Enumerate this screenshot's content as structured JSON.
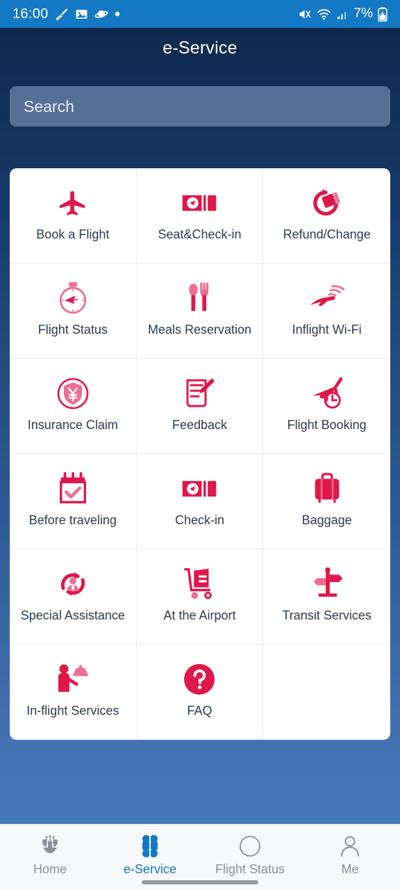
{
  "statusbar": {
    "time": "16:00",
    "icons_left": [
      "pen-icon",
      "photo-icon",
      "saturn-icon",
      "dot-icon"
    ],
    "icons_right": [
      "mute-icon",
      "wifi-icon",
      "signal-icon"
    ],
    "battery_text": "7%",
    "battery_icon": "battery-charging-icon",
    "bg_color": "#1379c4"
  },
  "header": {
    "title": "e-Service"
  },
  "search": {
    "placeholder": "Search",
    "icon": "search-field"
  },
  "theme": {
    "brand_pink": "#e0174b",
    "brand_pink_light": "#ee6f92",
    "accent_blue": "#1379c4",
    "bg_top": "#102a4c",
    "bg_bottom": "#4678b8",
    "card_bg": "#ffffff",
    "label_color": "#2b3a52"
  },
  "grid": {
    "items": [
      {
        "label": "Book a Flight",
        "icon": "airplane-icon"
      },
      {
        "label": "Seat&Check-in",
        "icon": "ticket-plane-icon"
      },
      {
        "label": "Refund/Change",
        "icon": "refund-ticket-icon"
      },
      {
        "label": "Flight Status",
        "icon": "stopwatch-plane-icon"
      },
      {
        "label": "Meals Reservation",
        "icon": "spoon-fork-icon"
      },
      {
        "label": "Inflight Wi-Fi",
        "icon": "plane-wifi-icon"
      },
      {
        "label": "Insurance Claim",
        "icon": "shield-yen-icon"
      },
      {
        "label": "Feedback",
        "icon": "note-pencil-icon"
      },
      {
        "label": "Flight Booking",
        "icon": "plane-clock-icon"
      },
      {
        "label": "Before traveling",
        "icon": "calendar-check-icon"
      },
      {
        "label": "Check-in",
        "icon": "ticket-plane-icon"
      },
      {
        "label": "Baggage",
        "icon": "suitcase-icon"
      },
      {
        "label": "Special Assistance",
        "icon": "person-arrows-icon"
      },
      {
        "label": "At the Airport",
        "icon": "luggage-cart-icon"
      },
      {
        "label": "Transit Services",
        "icon": "signpost-icon"
      },
      {
        "label": "In-flight Services",
        "icon": "steward-tray-icon"
      },
      {
        "label": "FAQ",
        "icon": "question-circle-icon"
      },
      {
        "label": "",
        "icon": ""
      }
    ]
  },
  "tabbar": {
    "items": [
      {
        "label": "Home",
        "icon": "flower-logo-icon",
        "active": false
      },
      {
        "label": "e-Service",
        "icon": "clover-grid-icon",
        "active": true
      },
      {
        "label": "Flight Status",
        "icon": "compass-icon",
        "active": false
      },
      {
        "label": "Me",
        "icon": "person-icon",
        "active": false
      }
    ]
  }
}
